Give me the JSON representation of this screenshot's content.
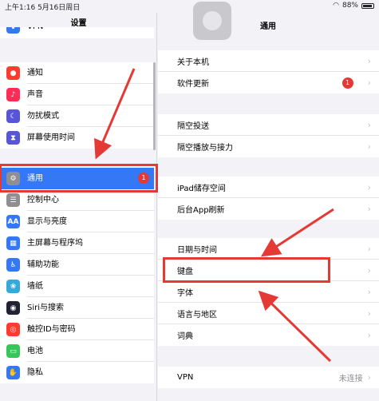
{
  "status_bar": {
    "time_date": "上午1:16  5月16日周日",
    "battery": "88%"
  },
  "sidebar": {
    "title": "设置",
    "group_top": {
      "label": "VPN"
    },
    "group1": [
      {
        "label": "通知",
        "icon": "notification-icon",
        "color": "#ff3b30",
        "glyph": "●"
      },
      {
        "label": "声音",
        "icon": "sound-icon",
        "color": "#ff2d55",
        "glyph": "♪"
      },
      {
        "label": "勿扰模式",
        "icon": "moon-icon",
        "color": "#5856d6",
        "glyph": "☾"
      },
      {
        "label": "屏幕使用时间",
        "icon": "hourglass-icon",
        "color": "#5856d6",
        "glyph": "⧗"
      }
    ],
    "group2": [
      {
        "label": "通用",
        "icon": "gear-icon",
        "color": "#8e8e93",
        "glyph": "⚙",
        "selected": true,
        "badge": "1"
      },
      {
        "label": "控制中心",
        "icon": "control-center-icon",
        "color": "#8e8e93",
        "glyph": "☰"
      },
      {
        "label": "显示与亮度",
        "icon": "display-icon",
        "color": "#3478f6",
        "glyph": "AA"
      },
      {
        "label": "主屏幕与程序坞",
        "icon": "home-screen-icon",
        "color": "#3478f6",
        "glyph": "▦"
      },
      {
        "label": "辅助功能",
        "icon": "accessibility-icon",
        "color": "#3478f6",
        "glyph": "♿"
      },
      {
        "label": "墙纸",
        "icon": "wallpaper-icon",
        "color": "#34aadc",
        "glyph": "❀"
      },
      {
        "label": "Siri与搜索",
        "icon": "siri-icon",
        "color": "#222233",
        "glyph": "◉"
      },
      {
        "label": "触控ID与密码",
        "icon": "touch-id-icon",
        "color": "#ff3b30",
        "glyph": "◎"
      },
      {
        "label": "电池",
        "icon": "battery-icon",
        "color": "#34c759",
        "glyph": "▭"
      },
      {
        "label": "隐私",
        "icon": "privacy-hand-icon",
        "color": "#3478f6",
        "glyph": "✋"
      }
    ]
  },
  "detail": {
    "title": "通用",
    "group1": [
      {
        "label": "关于本机"
      },
      {
        "label": "软件更新",
        "badge": "1"
      }
    ],
    "group2": [
      {
        "label": "隔空投送"
      },
      {
        "label": "隔空播放与接力"
      }
    ],
    "group3": [
      {
        "label": "iPad储存空间"
      },
      {
        "label": "后台App刷新"
      }
    ],
    "group4": [
      {
        "label": "日期与时间"
      },
      {
        "label": "键盘",
        "highlighted": true
      },
      {
        "label": "字体"
      },
      {
        "label": "语言与地区"
      },
      {
        "label": "词典"
      }
    ],
    "group5": [
      {
        "label": "VPN",
        "value": "未连接"
      }
    ]
  },
  "annotation_color": "#e53935"
}
